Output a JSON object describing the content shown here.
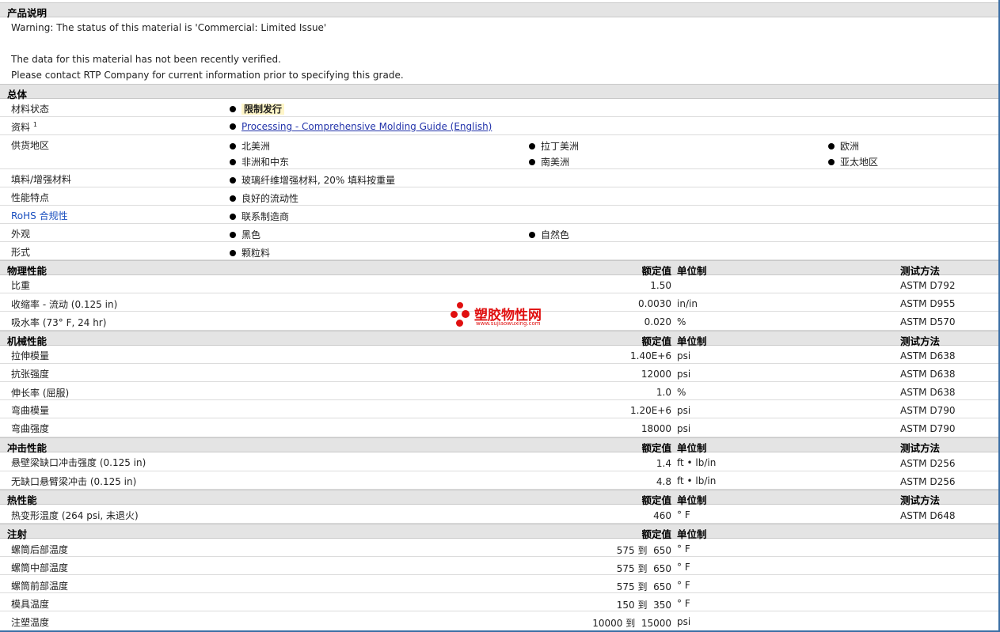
{
  "sections": {
    "description": "产品说明",
    "general": "总体",
    "physical": "物理性能",
    "mechanical": "机械性能",
    "impact": "冲击性能",
    "thermal": "热性能",
    "injection": "注射"
  },
  "columns": {
    "nominal": "额定值",
    "unit": "单位制",
    "test": "测试方法"
  },
  "notes": {
    "warning": "Warning: The status of this material is 'Commercial: Limited Issue'",
    "verify": "The data for this material has not been recently verified.",
    "contact": "Please contact RTP Company for current information prior to specifying this grade."
  },
  "general": {
    "status_label": "材料状态",
    "status_value": "限制发行",
    "docs_label": "资料",
    "docs_sup": "1",
    "docs_link": "Processing - Comprehensive Molding Guide (English)",
    "supply_label": "供货地区",
    "supply": [
      "北美洲",
      "拉丁美洲",
      "欧洲",
      "非洲和中东",
      "南美洲",
      "亚太地区"
    ],
    "filler_label": "填料/增强材料",
    "filler_value": "玻璃纤维增强材料, 20% 填料按重量",
    "features_label": "性能特点",
    "features_value": "良好的流动性",
    "rohs_label": "RoHS 合规性",
    "rohs_value": "联系制造商",
    "appearance_label": "外观",
    "appearance": [
      "黑色",
      "自然色"
    ],
    "form_label": "形式",
    "form_value": "颗粒料"
  },
  "physical": [
    {
      "name": "比重",
      "value": "1.50",
      "unit": "",
      "test": "ASTM D792"
    },
    {
      "name": "收缩率 - 流动 (0.125 in)",
      "value": "0.0030",
      "unit": "in/in",
      "test": "ASTM D955"
    },
    {
      "name": "吸水率 (73° F, 24 hr)",
      "value": "0.020",
      "unit": "%",
      "test": "ASTM D570"
    }
  ],
  "mechanical": [
    {
      "name": "拉伸模量",
      "value": "1.40E+6",
      "unit": "psi",
      "test": "ASTM D638"
    },
    {
      "name": "抗张强度",
      "value": "12000",
      "unit": "psi",
      "test": "ASTM D638"
    },
    {
      "name": "伸长率 (屈服)",
      "value": "1.0",
      "unit": "%",
      "test": "ASTM D638"
    },
    {
      "name": "弯曲模量",
      "value": "1.20E+6",
      "unit": "psi",
      "test": "ASTM D790"
    },
    {
      "name": "弯曲强度",
      "value": "18000",
      "unit": "psi",
      "test": "ASTM D790"
    }
  ],
  "impact": [
    {
      "name": "悬壁梁缺口冲击强度 (0.125 in)",
      "value": "1.4",
      "unit": "ft • lb/in",
      "test": "ASTM D256"
    },
    {
      "name": "无缺口悬臂梁冲击 (0.125 in)",
      "value": "4.8",
      "unit": "ft • lb/in",
      "test": "ASTM D256"
    }
  ],
  "thermal": [
    {
      "name": "热变形温度 (264 psi, 未退火)",
      "value": "460",
      "unit": "° F",
      "test": "ASTM D648"
    }
  ],
  "injection": [
    {
      "name": "螺筒后部温度",
      "value": "575 到  650",
      "unit": "° F"
    },
    {
      "name": "螺筒中部温度",
      "value": "575 到  650",
      "unit": "° F"
    },
    {
      "name": "螺筒前部温度",
      "value": "575 到  650",
      "unit": "° F"
    },
    {
      "name": "模具温度",
      "value": "150 到  350",
      "unit": "° F"
    },
    {
      "name": "注塑温度",
      "value": "10000 到  15000",
      "unit": "psi"
    }
  ],
  "watermark": {
    "name": "塑胶物性网",
    "url": "www.sujiaowuxing.com",
    "color": "#e01010"
  }
}
